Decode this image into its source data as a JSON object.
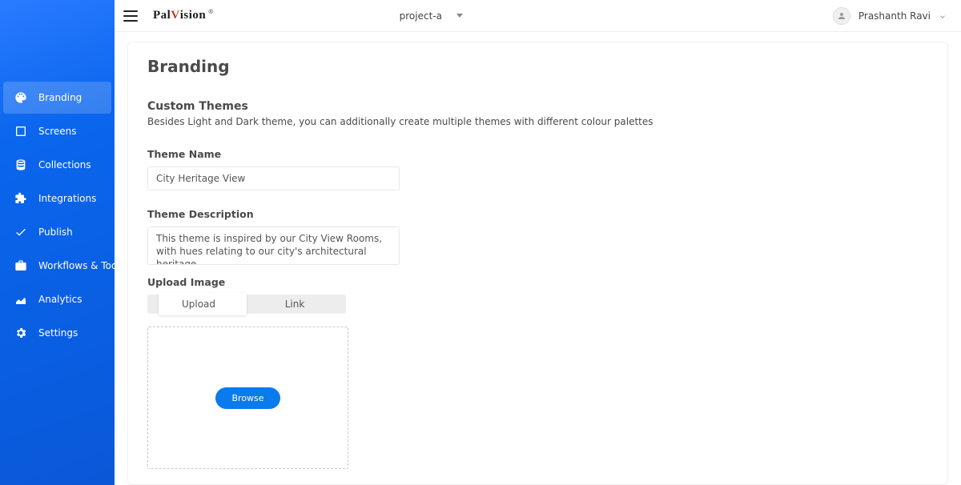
{
  "logo": {
    "part1": "Pal",
    "accent": "V",
    "part2": "ision",
    "sup": "®"
  },
  "project": {
    "name": "project-a"
  },
  "user": {
    "name": "Prashanth Ravi"
  },
  "sidebar": {
    "items": [
      {
        "label": "Branding"
      },
      {
        "label": "Screens"
      },
      {
        "label": "Collections"
      },
      {
        "label": "Integrations"
      },
      {
        "label": "Publish"
      },
      {
        "label": "Workflows & Tools"
      },
      {
        "label": "Analytics"
      },
      {
        "label": "Settings"
      }
    ]
  },
  "page": {
    "title": "Branding",
    "section_title": "Custom Themes",
    "section_desc": "Besides Light and Dark theme, you can additionally create multiple themes with different colour palettes",
    "theme_name_label": "Theme Name",
    "theme_name_value": "City Heritage View",
    "theme_desc_label": "Theme Description",
    "theme_desc_value": "This theme is inspired by our City View Rooms, with hues relating to our city's architectural heritage",
    "upload_label": "Upload Image",
    "tabs": {
      "upload": "Upload",
      "link": "Link"
    },
    "browse": "Browse"
  }
}
